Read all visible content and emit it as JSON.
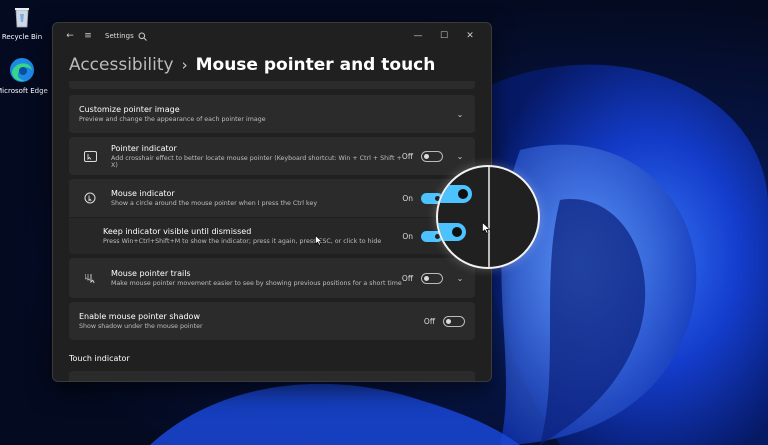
{
  "desktop": {
    "icons": [
      {
        "label": "Recycle Bin",
        "icon": "recycle-bin-icon"
      },
      {
        "label": "Microsoft Edge",
        "icon": "edge-icon"
      }
    ]
  },
  "window": {
    "title": "Settings",
    "breadcrumb": {
      "parent": "Accessibility",
      "separator": "›",
      "current": "Mouse pointer and touch"
    },
    "controls": {
      "minimize": "—",
      "maximize": "☐",
      "close": "✕"
    }
  },
  "settings": [
    {
      "title": "Customize pointer image",
      "desc": "Preview and change the appearance of each pointer image",
      "state": "",
      "expand": "⌄"
    },
    {
      "title": "Pointer indicator",
      "desc": "Add crosshair effect to better locate mouse pointer (Keyboard shortcut: Win + Ctrl + Shift + X)",
      "state": "Off",
      "expand": "⌄"
    },
    {
      "title": "Mouse indicator",
      "desc": "Show a circle around the mouse pointer when I press the Ctrl key",
      "state": "On",
      "expand": "⌃"
    },
    {
      "title": "Keep indicator visible until dismissed",
      "desc": "Press Win+Ctrl+Shift+M to show the indicator; press it again, press ESC, or click to hide",
      "state": "On",
      "expand": ""
    },
    {
      "title": "Mouse pointer trails",
      "desc": "Make mouse pointer movement easier to see by showing previous positions for a short time",
      "state": "Off",
      "expand": "⌄"
    },
    {
      "title": "Enable mouse pointer shadow",
      "desc": "Show shadow under the mouse pointer",
      "state": "Off",
      "expand": ""
    }
  ],
  "touch_section": {
    "label": "Touch indicator"
  },
  "colors": {
    "accent": "#4cc2ff",
    "window_bg": "#202020",
    "card_bg": "#2b2b2b"
  }
}
